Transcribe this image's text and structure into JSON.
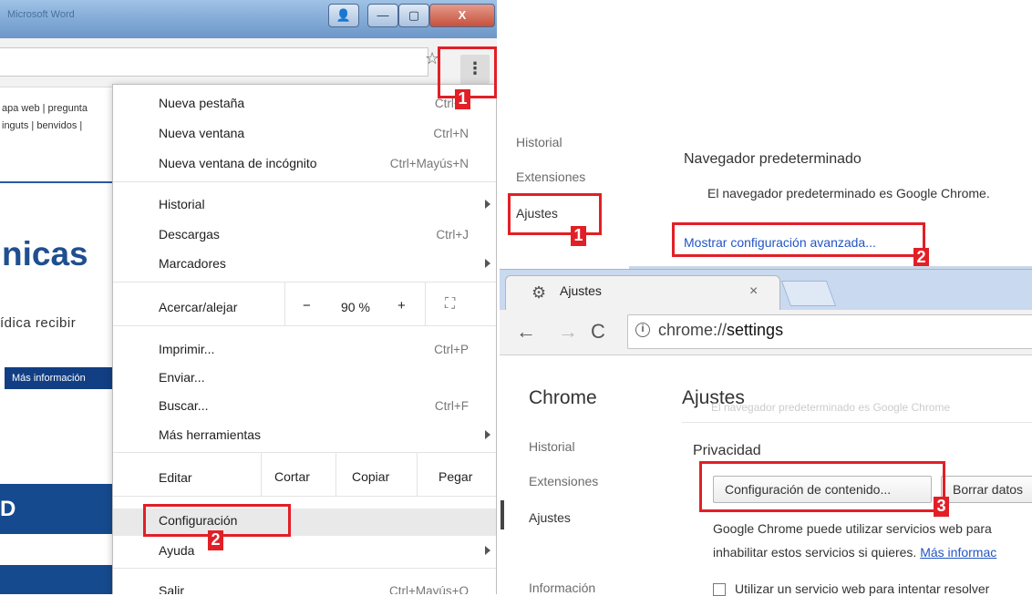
{
  "left_window": {
    "title": "Microsoft Word",
    "window_buttons": {
      "user": "👤",
      "minimize": "—",
      "maximize": "▢",
      "close": "X"
    },
    "star_icon": "☆",
    "menu_icon": "⋮",
    "page": {
      "links_line_1": "apa web  | pregunta",
      "links_line_2": "inguts | benvidos |",
      "heading": "nicas",
      "text": "ídica recibir",
      "button": "Más información",
      "band_text": "D"
    }
  },
  "chrome_menu": {
    "new_tab": {
      "label": "Nueva pestaña",
      "shortcut": "Ctrl+T"
    },
    "new_window": {
      "label": "Nueva ventana",
      "shortcut": "Ctrl+N"
    },
    "incognito": {
      "label": "Nueva ventana de incógnito",
      "shortcut": "Ctrl+Mayús+N"
    },
    "history": {
      "label": "Historial"
    },
    "downloads": {
      "label": "Descargas",
      "shortcut": "Ctrl+J"
    },
    "bookmarks": {
      "label": "Marcadores"
    },
    "zoom": {
      "label": "Acercar/alejar",
      "minus": "−",
      "value": "90 %",
      "plus": "+",
      "fullscreen": "⛶"
    },
    "print": {
      "label": "Imprimir...",
      "shortcut": "Ctrl+P"
    },
    "send": {
      "label": "Enviar..."
    },
    "find": {
      "label": "Buscar...",
      "shortcut": "Ctrl+F"
    },
    "more_tools": {
      "label": "Más herramientas"
    },
    "edit": {
      "label": "Editar",
      "cut": "Cortar",
      "copy": "Copiar",
      "paste": "Pegar"
    },
    "settings": {
      "label": "Configuración"
    },
    "help": {
      "label": "Ayuda"
    },
    "exit": {
      "label": "Salir",
      "shortcut": "Ctrl+Mayús+Q"
    }
  },
  "callouts": {
    "one": "1",
    "two": "2",
    "three": "3"
  },
  "settings_top": {
    "nav": [
      "Historial",
      "Extensiones",
      "Ajustes"
    ],
    "heading": "Navegador predeterminado",
    "description": "El navegador predeterminado es Google Chrome.",
    "advanced_link": "Mostrar configuración avanzada..."
  },
  "settings_bottom": {
    "tab_title": "Ajustes",
    "tab_close": "×",
    "url_prefix": "chrome://",
    "url_path": "settings",
    "nav": {
      "chrome": "Chrome",
      "history": "Historial",
      "extensions": "Extensiones",
      "settings": "Ajustes",
      "info": "Información"
    },
    "page_title": "Ajustes",
    "ghost_text": "El navegador predeterminado es Google Chrome",
    "privacy": "Privacidad",
    "content_button": "Configuración de contenido...",
    "clear_button": "Borrar datos",
    "desc_1": "Google Chrome puede utilizar servicios web para",
    "desc_2": "inhabilitar estos servicios si quieres.",
    "more_info": "Más informac",
    "checkbox_label": "Utilizar un servicio web para intentar resolver"
  },
  "colors": {
    "callout": "#e21f26",
    "link": "#2255c4",
    "page_blue": "#164a8e"
  }
}
